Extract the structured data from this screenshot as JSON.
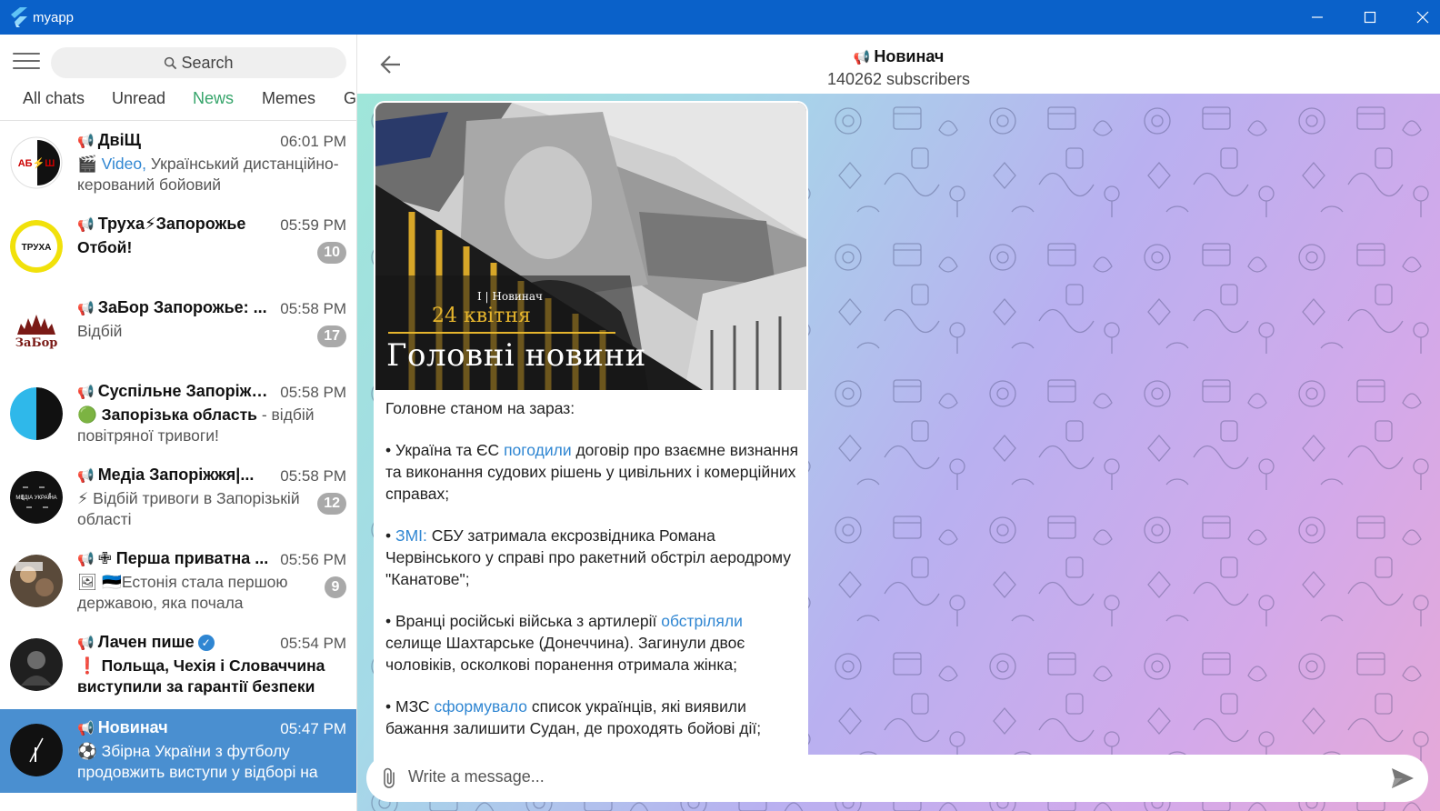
{
  "window": {
    "title": "myapp"
  },
  "sidebar": {
    "search_label": "Search",
    "tabs": [
      "All chats",
      "Unread",
      "News",
      "Memes",
      "G"
    ],
    "active_tab": "News",
    "chats": [
      {
        "name": "ДвіЩ",
        "time": "06:01 PM",
        "preview_prefix": "Video,",
        "preview": " Український дистанційно-керований бойовий",
        "badge": ""
      },
      {
        "name": "Труха⚡Запорожье",
        "time": "05:59 PM",
        "preview": "Отбой!",
        "badge": "10"
      },
      {
        "name": "ЗаБор Запорожье: ...",
        "time": "05:58 PM",
        "preview": "Відбій",
        "badge": "17"
      },
      {
        "name": "Суспільне Запоріжж...",
        "time": "05:58 PM",
        "preview_bold": "🟢 Запорізька область",
        "preview": " - відбій повітряної тривоги!",
        "badge": ""
      },
      {
        "name": "Медіа Запоріжжя|...",
        "time": "05:58 PM",
        "preview": "⚡ Відбій тривоги в Запорізькій області",
        "badge": "12"
      },
      {
        "name": "✙ Перша приватна ...",
        "time": "05:56 PM",
        "preview": "🇪🇪Естонія стала першою державою, яка почала",
        "badge": "9"
      },
      {
        "name": "Лачен пише",
        "time": "05:54 PM",
        "preview_bold": "❗ Польща, Чехія і Словаччина виступили за гарантії безпеки",
        "preview": "",
        "badge": ""
      },
      {
        "name": "Новинач",
        "time": "05:47 PM",
        "preview": "Збірна України з футболу продовжить виступи у відборі на",
        "badge": ""
      }
    ],
    "avatar_labels": {
      "dvishch": "АБ⚡Ш",
      "trukha": "ТРУХА",
      "zabor": "ЗаБор",
      "media": "МЕДІА УКРАЇНА"
    }
  },
  "chat": {
    "title": "Новинач",
    "subtitle": "140262 subscribers",
    "post": {
      "image_brand": "І | Новинач",
      "image_date": "24 квітня",
      "image_title": "Головні новини",
      "intro": "Головне станом на зараз:",
      "items": [
        {
          "before": "• Україна та ЄС ",
          "link": "погодили",
          "after": " договір про взаємне визнання та виконання судових рішень у цивільних і комерційних справах;"
        },
        {
          "before": "• ",
          "link": "ЗМІ:",
          "after": " СБУ затримала ексрозвідника Романа Червінського у справі про ракетний обстріл аеродрому \"Канатове\";"
        },
        {
          "before": "• Вранці російські війська з артилерії ",
          "link": "обстріляли",
          "after": " селище Шахтарське (Донеччина). Загинули двоє чоловіків, осколкові поранення отримала жінка;"
        },
        {
          "before": "• МЗС ",
          "link": "сформувало",
          "after": " список українців, які виявили бажання залишити Судан, де проходять бойові дії;"
        }
      ]
    },
    "composer_placeholder": "Write a message..."
  },
  "colors": {
    "titlebar": "#0a61c9",
    "accent_tab": "#35a46a",
    "link": "#2f86d2",
    "selected_chat": "#4a8fd0",
    "badge": "#a9a9a9"
  },
  "icons": [
    "app-logo-icon",
    "minimize-icon",
    "maximize-icon",
    "close-icon",
    "hamburger-icon",
    "search-icon",
    "megaphone-icon",
    "verified-icon",
    "back-arrow-icon",
    "attach-icon",
    "send-icon"
  ]
}
